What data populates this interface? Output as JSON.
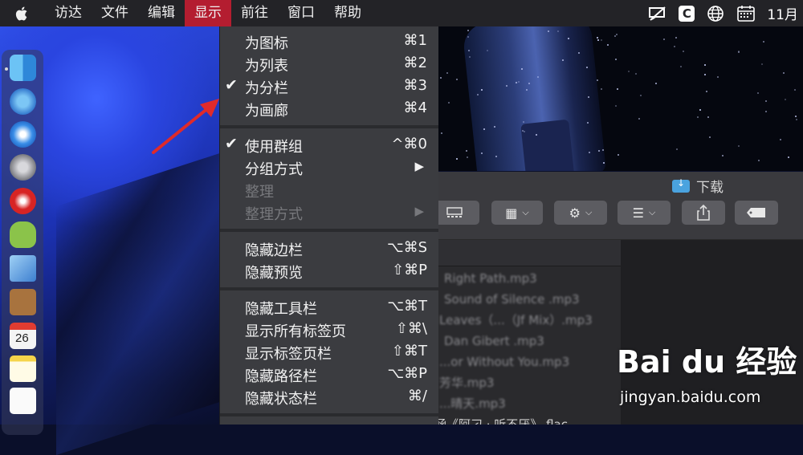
{
  "menubar": {
    "apple": "",
    "items": [
      "访达",
      "文件",
      "编辑",
      "显示",
      "前往",
      "窗口",
      "帮助"
    ],
    "active_index": 3,
    "status": {
      "c_icon": "C",
      "clock": "11月"
    }
  },
  "menu": {
    "groups": [
      [
        {
          "label": "为图标",
          "shortcut": "⌘1",
          "checked": false
        },
        {
          "label": "为列表",
          "shortcut": "⌘2",
          "checked": false
        },
        {
          "label": "为分栏",
          "shortcut": "⌘3",
          "checked": true
        },
        {
          "label": "为画廊",
          "shortcut": "⌘4",
          "checked": false
        }
      ],
      [
        {
          "label": "使用群组",
          "shortcut": "^⌘0",
          "checked": true
        },
        {
          "label": "分组方式",
          "submenu": true
        },
        {
          "label": "整理",
          "disabled": true
        },
        {
          "label": "整理方式",
          "submenu": true,
          "disabled": true
        }
      ],
      [
        {
          "label": "隐藏边栏",
          "shortcut": "⌥⌘S"
        },
        {
          "label": "隐藏预览",
          "shortcut": "⇧⌘P"
        }
      ],
      [
        {
          "label": "隐藏工具栏",
          "shortcut": "⌥⌘T"
        },
        {
          "label": "显示所有标签页",
          "shortcut": "⇧⌘\\"
        },
        {
          "label": "显示标签页栏",
          "shortcut": "⇧⌘T"
        },
        {
          "label": "隐藏路径栏",
          "shortcut": "⌥⌘P"
        },
        {
          "label": "隐藏状态栏",
          "shortcut": "⌘/"
        }
      ]
    ]
  },
  "finder": {
    "title": "下载",
    "files": [
      "Right Path.mp3",
      "Sound of Silence .mp3",
      "Leaves（...（Jf Mix）.mp3",
      "Dan Gibert .mp3",
      "...or Without You.mp3",
      "芳华.mp3",
      "...晴天.mp3",
      "涵《阿刁 · 听不厌》.flac"
    ]
  },
  "watermark": {
    "logo": "Bai du 经验",
    "url": "jingyan.baidu.com"
  },
  "colors": {
    "menubar": "#232327",
    "active_menu": "#b41d30",
    "menu_bg": "#3b3c40",
    "arrow": "#e02a2a"
  }
}
